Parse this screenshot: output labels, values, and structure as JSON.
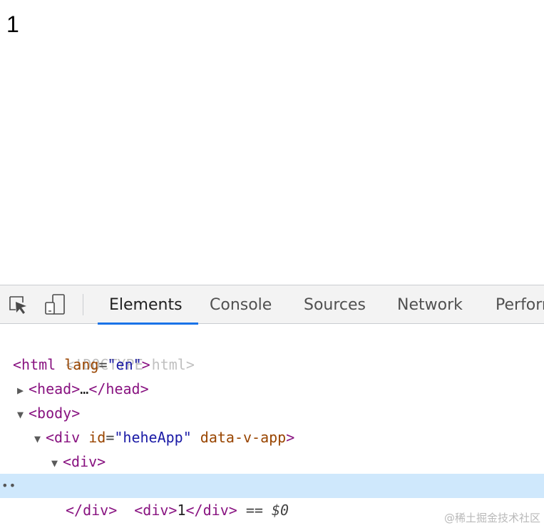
{
  "viewport": {
    "text": "1"
  },
  "devtools": {
    "toolbar": {
      "inspect_icon": "element-picker-icon",
      "device_icon": "device-toggle-icon",
      "tabs": [
        {
          "label": "Elements",
          "active": true
        },
        {
          "label": "Console",
          "active": false
        },
        {
          "label": "Sources",
          "active": false
        },
        {
          "label": "Network",
          "active": false
        },
        {
          "label": "Perform",
          "active": false
        }
      ]
    },
    "dom": {
      "doctype": "<!DOCTYPE html>",
      "html_tag": "html",
      "html_attr": "lang",
      "html_attr_value": "\"en\"",
      "head_tag": "head",
      "head_ellipsis": "…",
      "body_tag": "body",
      "app_div_tag": "div",
      "app_div_id_attr": "id",
      "app_div_id_value": "\"heheApp\"",
      "app_div_data_attr": "data-v-app",
      "inner_div_tag": "div",
      "selected_div_tag": "div",
      "selected_div_text": "1",
      "selected_marker": "== $0",
      "gutter": "••",
      "close_div_tag": "div"
    },
    "colors": {
      "tag": "#881280",
      "attr_name": "#994500",
      "attr_value": "#1a1aa6",
      "selected_row": "#cfe8fc",
      "active_tab_underline": "#1a73e8"
    }
  },
  "watermark": "@稀土掘金技术社区"
}
